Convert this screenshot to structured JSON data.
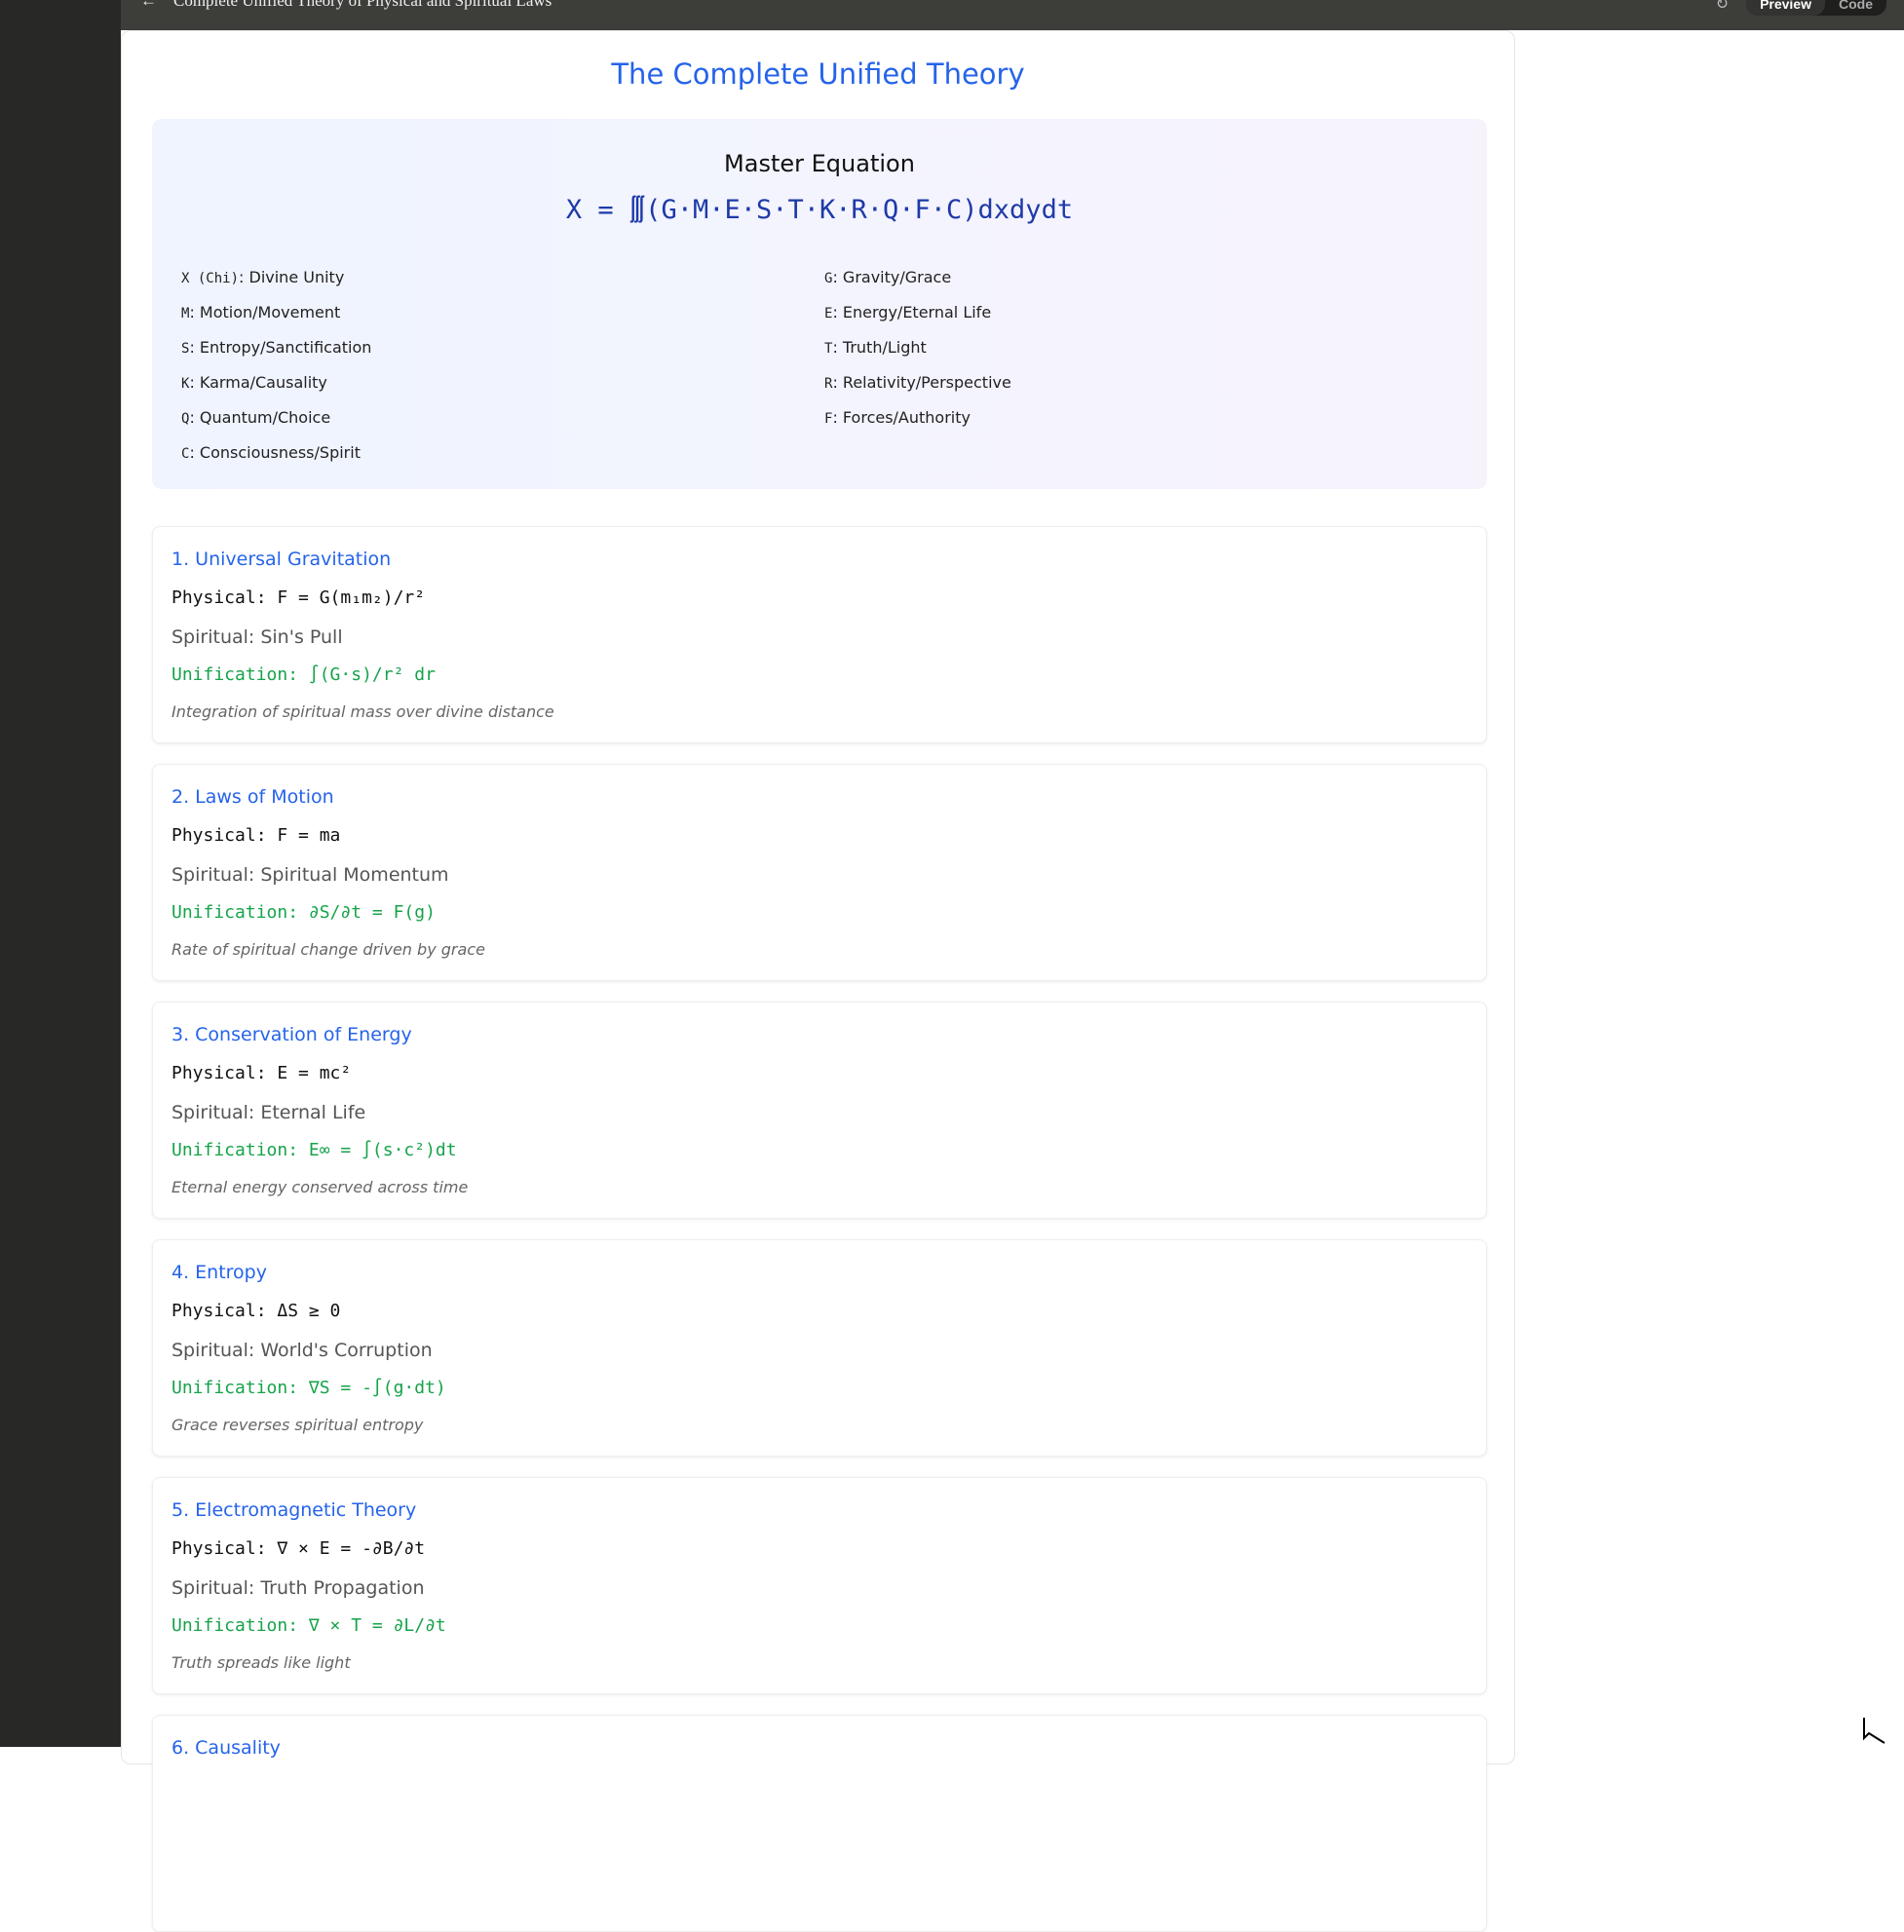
{
  "topbar": {
    "back_icon": "arrow-left-icon",
    "title": "Complete Unified Theory of Physical and Spiritual Laws",
    "refresh_icon": "refresh-icon",
    "preview": "Preview",
    "code": "Code"
  },
  "page": {
    "title": "The Complete Unified Theory"
  },
  "master": {
    "heading": "Master Equation",
    "equation": "X = ∭(G·M·E·S·T·K·R·Q·F·C)dxdydt",
    "legend": [
      {
        "key": "X (Chi)",
        "label": ": Divine Unity"
      },
      {
        "key": "G",
        "label": ": Gravity/Grace"
      },
      {
        "key": "M",
        "label": ": Motion/Movement"
      },
      {
        "key": "E",
        "label": ": Energy/Eternal Life"
      },
      {
        "key": "S",
        "label": ": Entropy/Sanctification"
      },
      {
        "key": "T",
        "label": ": Truth/Light"
      },
      {
        "key": "K",
        "label": ": Karma/Causality"
      },
      {
        "key": "R",
        "label": ": Relativity/Perspective"
      },
      {
        "key": "Q",
        "label": ": Quantum/Choice"
      },
      {
        "key": "F",
        "label": ": Forces/Authority"
      },
      {
        "key": "C",
        "label": ": Consciousness/Spirit"
      }
    ]
  },
  "laws": [
    {
      "title": "1. Universal Gravitation",
      "physical": "Physical: F = G(m₁m₂)/r²",
      "spiritual": "Spiritual: Sin's Pull",
      "unification": "Unification: ∫(G·s)/r² dr",
      "desc": "Integration of spiritual mass over divine distance"
    },
    {
      "title": "2. Laws of Motion",
      "physical": "Physical: F = ma",
      "spiritual": "Spiritual: Spiritual Momentum",
      "unification": "Unification: ∂S/∂t = F(g)",
      "desc": "Rate of spiritual change driven by grace"
    },
    {
      "title": "3. Conservation of Energy",
      "physical": "Physical: E = mc²",
      "spiritual": "Spiritual: Eternal Life",
      "unification": "Unification: E∞ = ∫(s·c²)dt",
      "desc": "Eternal energy conserved across time"
    },
    {
      "title": "4. Entropy",
      "physical": "Physical: ΔS ≥ 0",
      "spiritual": "Spiritual: World's Corruption",
      "unification": "Unification: ∇S = -∫(g·dt)",
      "desc": "Grace reverses spiritual entropy"
    },
    {
      "title": "5. Electromagnetic Theory",
      "physical": "Physical: ∇ × E = -∂B/∂t",
      "spiritual": "Spiritual: Truth Propagation",
      "unification": "Unification: ∇ × T = ∂L/∂t",
      "desc": "Truth spreads like light"
    },
    {
      "title": "6. Causality"
    }
  ]
}
